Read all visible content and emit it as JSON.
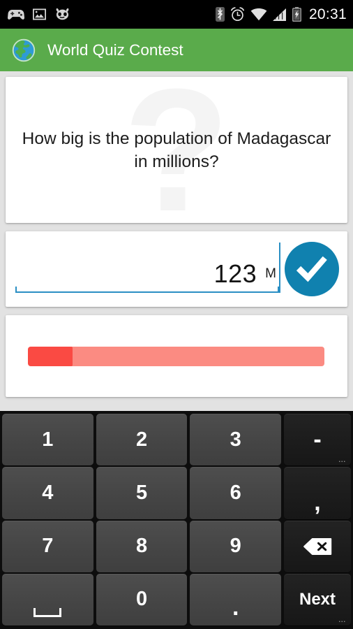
{
  "statusbar": {
    "time": "20:31",
    "left_icons": [
      "gamepad-icon",
      "image-icon",
      "cyanogenmod-icon"
    ],
    "right_icons": [
      "bluetooth-icon",
      "alarm-icon",
      "wifi-icon",
      "signal-icon",
      "battery-charging-icon"
    ]
  },
  "appbar": {
    "title": "World Quiz Contest",
    "icon": "globe-icon",
    "color": "#5aab4b"
  },
  "question": {
    "text": "How big is the population of Madagascar in millions?",
    "watermark": "?"
  },
  "answer": {
    "value": "123",
    "unit": "M",
    "submit_icon": "check-icon",
    "accent_color": "#1081af",
    "underline_color": "#2a8fc4"
  },
  "progress": {
    "percent": 15,
    "fill_color": "#fa4a43",
    "track_color": "#fb8b82"
  },
  "keyboard": {
    "rows": [
      [
        {
          "label": "1",
          "name": "key-1",
          "type": "digit"
        },
        {
          "label": "2",
          "name": "key-2",
          "type": "digit"
        },
        {
          "label": "3",
          "name": "key-3",
          "type": "digit"
        },
        {
          "label": "-",
          "name": "key-dash",
          "type": "fn",
          "hint": "..."
        }
      ],
      [
        {
          "label": "4",
          "name": "key-4",
          "type": "digit"
        },
        {
          "label": "5",
          "name": "key-5",
          "type": "digit"
        },
        {
          "label": "6",
          "name": "key-6",
          "type": "digit"
        },
        {
          "label": ",",
          "name": "key-comma",
          "type": "fn"
        }
      ],
      [
        {
          "label": "7",
          "name": "key-7",
          "type": "digit"
        },
        {
          "label": "8",
          "name": "key-8",
          "type": "digit"
        },
        {
          "label": "9",
          "name": "key-9",
          "type": "digit"
        },
        {
          "label": "",
          "name": "key-backspace",
          "type": "fn",
          "icon": "backspace-icon"
        }
      ],
      [
        {
          "label": "",
          "name": "key-space",
          "type": "digit",
          "icon": "space-icon"
        },
        {
          "label": "0",
          "name": "key-0",
          "type": "digit"
        },
        {
          "label": ".",
          "name": "key-period",
          "type": "digit"
        },
        {
          "label": "Next",
          "name": "key-next",
          "type": "fn",
          "hint": "..."
        }
      ]
    ]
  }
}
